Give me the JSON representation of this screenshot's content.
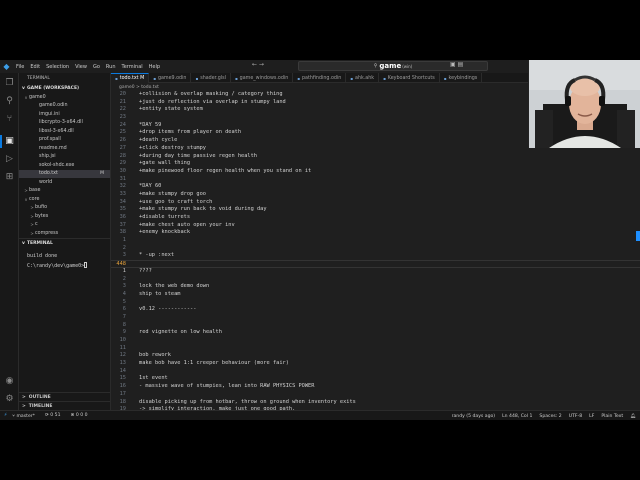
{
  "titlebar": {
    "menu": [
      "File",
      "Edit",
      "Selection",
      "View",
      "Go",
      "Run",
      "Terminal",
      "Help"
    ],
    "search": "game",
    "search_sub": "(win)"
  },
  "sidebar": {
    "header": "TERMINAL",
    "workspace": "GAME (WORKSPACE)",
    "items": [
      {
        "label": "game0",
        "chev": "v",
        "badge": ""
      },
      {
        "label": "game0.odin",
        "chev": "",
        "badge": ""
      },
      {
        "label": "imgui.ini",
        "chev": "",
        "badge": ""
      },
      {
        "label": "libcrypto-3-x64.dll",
        "chev": "",
        "badge": ""
      },
      {
        "label": "libssl-3-x64.dll",
        "chev": "",
        "badge": ""
      },
      {
        "label": "prof.spall",
        "chev": "",
        "badge": ""
      },
      {
        "label": "readme.md",
        "chev": "",
        "badge": ""
      },
      {
        "label": "ship.jsi",
        "chev": "",
        "badge": ""
      },
      {
        "label": "sokol-shdc.exe",
        "chev": "",
        "badge": ""
      },
      {
        "label": "todo.txt",
        "chev": "",
        "badge": "M"
      },
      {
        "label": "world",
        "chev": "",
        "badge": ""
      },
      {
        "label": "base",
        "chev": ">",
        "badge": ""
      },
      {
        "label": "core",
        "chev": "v",
        "badge": ""
      },
      {
        "label": "bufio",
        "chev": ">",
        "badge": ""
      },
      {
        "label": "bytes",
        "chev": ">",
        "badge": ""
      },
      {
        "label": "c",
        "chev": ">",
        "badge": ""
      },
      {
        "label": "compress",
        "chev": ">",
        "badge": ""
      }
    ],
    "terminal_title": "TERMINAL",
    "terminal_lines": [
      "build done",
      "C:\\randy\\dev\\game0>"
    ],
    "outline": "OUTLINE",
    "timeline": "TIMELINE"
  },
  "tabs": [
    {
      "label": "todo.txt M",
      "active": true
    },
    {
      "label": "game9.odin",
      "active": false
    },
    {
      "label": "shader.glsl",
      "active": false
    },
    {
      "label": "game_windows.odin",
      "active": false
    },
    {
      "label": "pathfinding.odin",
      "active": false
    },
    {
      "label": "ahk.ahk",
      "active": false
    },
    {
      "label": "Keyboard Shortcuts",
      "active": false
    },
    {
      "label": "keybindings",
      "active": false
    }
  ],
  "breadcrumb": "game0 > todo.txt",
  "code_lines": [
    {
      "n": "20",
      "t": "+collision & overlap masking / category thing"
    },
    {
      "n": "21",
      "t": "+just do reflection via overlap in stumpy land"
    },
    {
      "n": "22",
      "t": "+entity state system"
    },
    {
      "n": "23",
      "t": ""
    },
    {
      "n": "24",
      "t": "*DAY 59"
    },
    {
      "n": "25",
      "t": "+drop items from player on death"
    },
    {
      "n": "26",
      "t": "+death cycle"
    },
    {
      "n": "27",
      "t": "+click destroy stumpy"
    },
    {
      "n": "28",
      "t": "+during day time passive regen health"
    },
    {
      "n": "29",
      "t": "+gate wall thing"
    },
    {
      "n": "30",
      "t": "+make pinewood floor regen health when you stand on it"
    },
    {
      "n": "31",
      "t": ""
    },
    {
      "n": "32",
      "t": "*DAY 60"
    },
    {
      "n": "33",
      "t": "+make stumpy drop goo"
    },
    {
      "n": "34",
      "t": "+use goo to craft torch"
    },
    {
      "n": "35",
      "t": "+make stumpy run back to void during day"
    },
    {
      "n": "36",
      "t": "+disable turrets"
    },
    {
      "n": "37",
      "t": "+make chest auto open your inv"
    },
    {
      "n": "38",
      "t": "+enemy knockback"
    },
    {
      "n": "1",
      "t": ""
    },
    {
      "n": "2",
      "t": ""
    },
    {
      "n": "3",
      "t": "* -up :next"
    },
    {
      "n": "448",
      "t": ""
    },
    {
      "n": "1",
      "t": "????"
    },
    {
      "n": "2",
      "t": ""
    },
    {
      "n": "3",
      "t": "lock the web demo down"
    },
    {
      "n": "4",
      "t": "ship to steam"
    },
    {
      "n": "5",
      "t": ""
    },
    {
      "n": "6",
      "t": "v0.12 ------------"
    },
    {
      "n": "7",
      "t": ""
    },
    {
      "n": "8",
      "t": ""
    },
    {
      "n": "9",
      "t": "red vignette on low health"
    },
    {
      "n": "10",
      "t": ""
    },
    {
      "n": "11",
      "t": ""
    },
    {
      "n": "12",
      "t": "bob rework"
    },
    {
      "n": "13",
      "t": "make bob have 1:1 creeper behaviour (more fair)"
    },
    {
      "n": "14",
      "t": ""
    },
    {
      "n": "15",
      "t": "1st event"
    },
    {
      "n": "16",
      "t": "- massive wave of stumpies, lean into RAW PHYSICS POWER"
    },
    {
      "n": "17",
      "t": ""
    },
    {
      "n": "18",
      "t": "disable picking up from hotbar, throw on ground when inventory exits"
    },
    {
      "n": "19",
      "t": "-> simplify interaction. make just one good path."
    },
    {
      "n": "20",
      "t": ""
    }
  ],
  "status": {
    "branch": "master*",
    "sync": "0 51",
    "problems": "0 0 0",
    "author": "randy (5 days ago)",
    "position": "Ln 448, Col 1",
    "spaces": "Spaces: 2",
    "encoding": "UTF-8",
    "eol": "LF",
    "language": "Plain Text"
  }
}
